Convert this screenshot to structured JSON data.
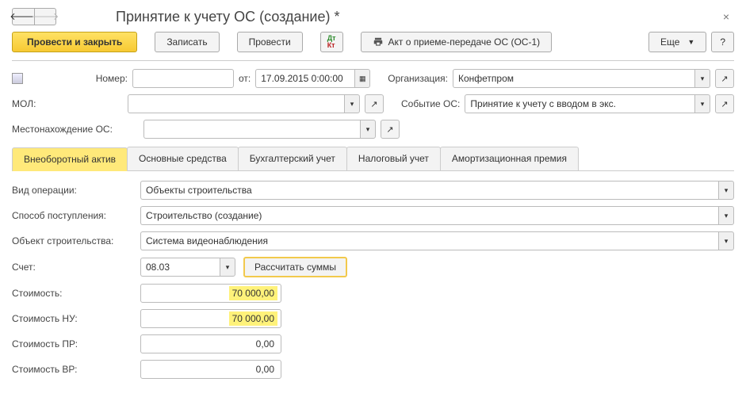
{
  "title": "Принятие к учету ОС (создание) *",
  "toolbar": {
    "post_close": "Провести и закрыть",
    "write": "Записать",
    "post": "Провести",
    "act": "Акт о приеме-передаче ОС (ОС-1)",
    "more": "Еще",
    "help": "?"
  },
  "header": {
    "number_lbl": "Номер:",
    "number": "",
    "date_lbl": "от:",
    "date": "17.09.2015 0:00:00",
    "org_lbl": "Организация:",
    "org": "Конфетпром",
    "mol_lbl": "МОЛ:",
    "mol": "",
    "event_lbl": "Событие ОС:",
    "event": "Принятие к учету с вводом в экс.",
    "loc_lbl": "Местонахождение ОС:",
    "loc": ""
  },
  "tabs": [
    "Внеоборотный актив",
    "Основные средства",
    "Бухгалтерский учет",
    "Налоговый учет",
    "Амортизационная премия"
  ],
  "form": {
    "op_type_lbl": "Вид операции:",
    "op_type": "Объекты строительства",
    "receipt_lbl": "Способ поступления:",
    "receipt": "Строительство (создание)",
    "obj_lbl": "Объект строительства:",
    "obj": "Система видеонаблюдения",
    "acct_lbl": "Счет:",
    "acct": "08.03",
    "calc": "Рассчитать суммы",
    "cost_lbl": "Стоимость:",
    "cost": "70 000,00",
    "cost_nu_lbl": "Стоимость НУ:",
    "cost_nu": "70 000,00",
    "cost_pr_lbl": "Стоимость ПР:",
    "cost_pr": "0,00",
    "cost_vr_lbl": "Стоимость ВР:",
    "cost_vr": "0,00"
  }
}
